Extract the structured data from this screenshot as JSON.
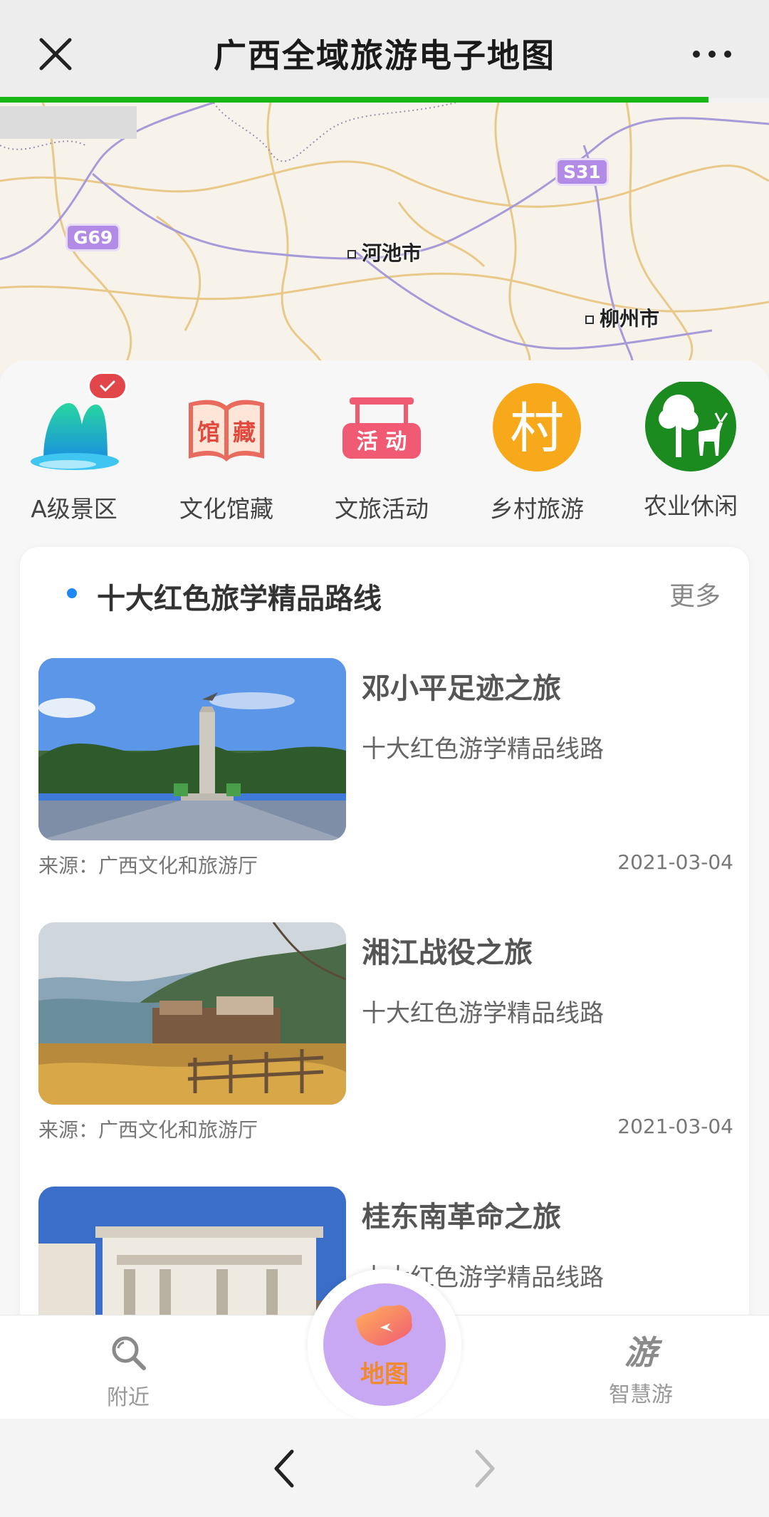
{
  "header": {
    "title": "广西全域旅游电子地图",
    "close_icon": "close-icon",
    "more_icon": "more-icon"
  },
  "map": {
    "highways": [
      "G69",
      "S31"
    ],
    "cities": [
      "河池市",
      "柳州市"
    ]
  },
  "categories": [
    {
      "label": "A级景区",
      "icon": "scenic-area-icon"
    },
    {
      "label": "文化馆藏",
      "icon": "museum-collection-icon",
      "icon_text": [
        "馆",
        "藏"
      ]
    },
    {
      "label": "文旅活动",
      "icon": "culture-event-icon",
      "icon_text": "活 动"
    },
    {
      "label": "乡村旅游",
      "icon": "village-icon",
      "icon_text": "村"
    },
    {
      "label": "农业休闲",
      "icon": "agriculture-icon"
    }
  ],
  "section": {
    "title": "十大红色旅学精品路线",
    "more_label": "更多",
    "items": [
      {
        "name": "邓小平足迹之旅",
        "subtitle": "十大红色游学精品线路",
        "source": "来源：广西文化和旅游厅",
        "date": "2021-03-04"
      },
      {
        "name": "湘江战役之旅",
        "subtitle": "十大红色游学精品线路",
        "source": "来源：广西文化和旅游厅",
        "date": "2021-03-04"
      },
      {
        "name": "桂东南革命之旅",
        "subtitle": "十大红色游学精品线路"
      }
    ]
  },
  "tabbar": {
    "nearby_label": "附近",
    "map_label": "地图",
    "smart_label": "智慧游",
    "smart_glyph": "游"
  },
  "colors": {
    "progress": "#15b814",
    "accent_blue": "#1e88f5",
    "map_button": "#c8a8f2",
    "map_label": "#f08a2c"
  }
}
